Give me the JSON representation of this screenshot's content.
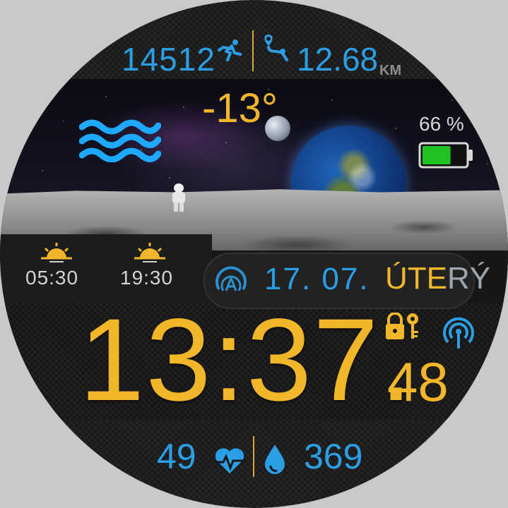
{
  "activity": {
    "steps": "14512",
    "distance": "12.68",
    "distance_unit": "KM"
  },
  "weather": {
    "temperature": "-13°",
    "icon": "waves-icon"
  },
  "battery": {
    "label": "66 %",
    "level": 0.66,
    "color": "#22c222"
  },
  "sun": {
    "sunrise": "05:30",
    "sunset": "19:30"
  },
  "date": {
    "date": "17. 07.",
    "day_highlight": "ÚTE",
    "day_tail": "RÝ"
  },
  "time": {
    "main": "13:37.",
    "seconds": "48"
  },
  "health": {
    "heart_rate": "49",
    "calories": "369"
  },
  "colors": {
    "accent_blue": "#2b9fe6",
    "accent_yellow": "#f2b62a",
    "divider_gold": "#d6a93a"
  }
}
